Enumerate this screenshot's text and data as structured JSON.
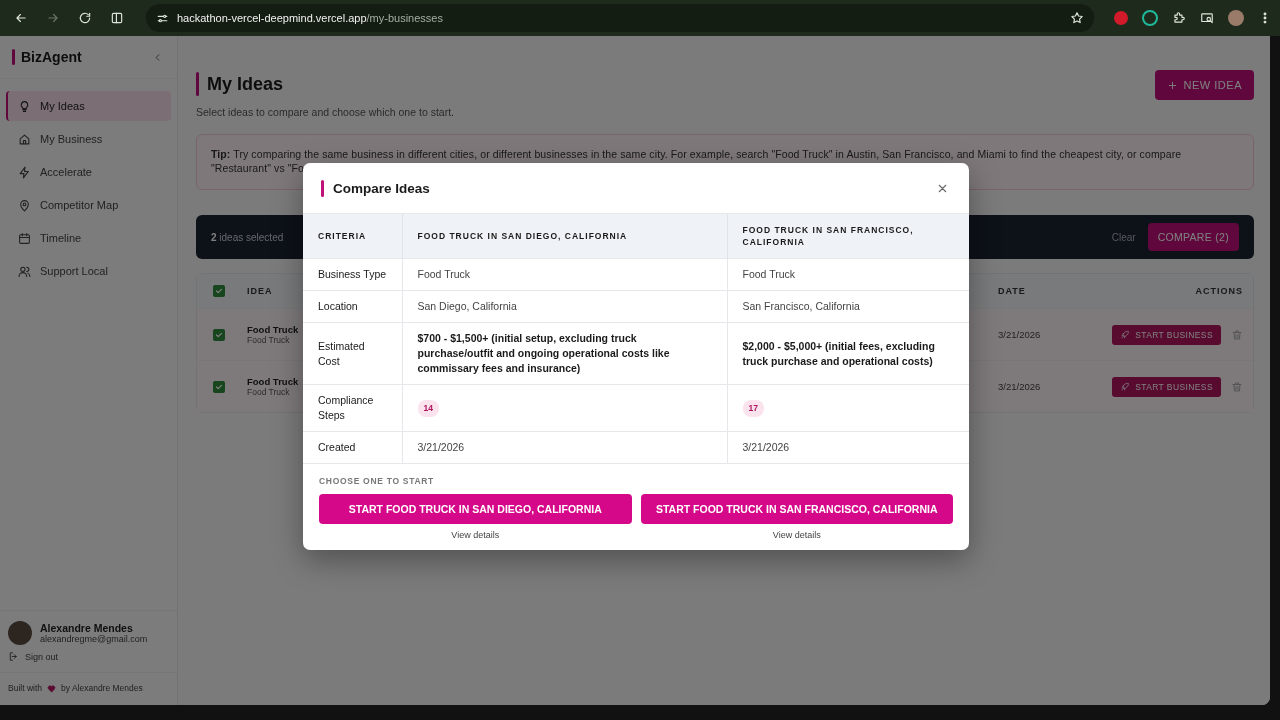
{
  "browser": {
    "host": "hackathon-vercel-deepmind.vercel.app",
    "path": "/my-businesses",
    "forward_disabled": true
  },
  "sidebar": {
    "brand": "BizAgent",
    "items": [
      {
        "label": "My Ideas",
        "selected": true
      },
      {
        "label": "My Business",
        "selected": false
      },
      {
        "label": "Accelerate",
        "selected": false
      },
      {
        "label": "Competitor Map",
        "selected": false
      },
      {
        "label": "Timeline",
        "selected": false
      },
      {
        "label": "Support Local",
        "selected": false
      }
    ],
    "user": {
      "name": "Alexandre Mendes",
      "email": "alexandregme@gmail.com"
    },
    "sign_out": "Sign out",
    "footer_before": "Built with",
    "footer_after": "by Alexandre Mendes"
  },
  "page": {
    "title": "My Ideas",
    "subtitle": "Select ideas to compare and choose which one to start.",
    "new_button": "NEW IDEA",
    "tip": "**Tip:** Try comparing the same business in different cities, or different businesses in the same city. For example, search \"Food Truck\" in Austin, San Francisco, and Miami to find the cheapest city, or compare \"Restaurant\" vs \"Fo"
  },
  "selection_bar": {
    "text": "**2** ideas selected",
    "clear": "Clear",
    "compare": "COMPARE (2)"
  },
  "ideas_table": {
    "columns": [
      "IDEA",
      "DATE",
      "ACTIONS"
    ],
    "all_checked": true,
    "rows": [
      {
        "title": "Food Truck",
        "subtitle": "Food Truck",
        "date": "3/21/2026",
        "action": "START BUSINESS",
        "checked": true
      },
      {
        "title": "Food Truck",
        "subtitle": "Food Truck",
        "date": "3/21/2026",
        "action": "START BUSINESS",
        "checked": true
      }
    ]
  },
  "modal": {
    "title": "Compare Ideas",
    "columns": [
      "CRITERIA",
      "FOOD TRUCK IN SAN DIEGO, CALIFORNIA",
      "FOOD TRUCK IN SAN FRANCISCO, CALIFORNIA"
    ],
    "rows": [
      {
        "label": "Business Type",
        "kind": "text",
        "values": [
          "Food Truck",
          "Food Truck"
        ]
      },
      {
        "label": "Location",
        "kind": "text",
        "values": [
          "San Diego, California",
          "San Francisco, California"
        ]
      },
      {
        "label": "Estimated Cost",
        "kind": "strong",
        "values": [
          "$700 - $1,500+ (initial setup, excluding truck purchase/outfit and ongoing operational costs like commissary fees and insurance)",
          "$2,000 - $5,000+ (initial fees, excluding truck purchase and operational costs)"
        ]
      },
      {
        "label": "Compliance Steps",
        "kind": "badge",
        "values": [
          "14",
          "17"
        ]
      },
      {
        "label": "Created",
        "kind": "text",
        "values": [
          "3/21/2026",
          "3/21/2026"
        ]
      }
    ],
    "choose_label": "CHOOSE ONE TO START",
    "options": [
      {
        "button": "START FOOD TRUCK IN SAN DIEGO, CALIFORNIA",
        "link": "View details"
      },
      {
        "button": "START FOOD TRUCK IN SAN FRANCISCO, CALIFORNIA",
        "link": "View details"
      }
    ]
  }
}
